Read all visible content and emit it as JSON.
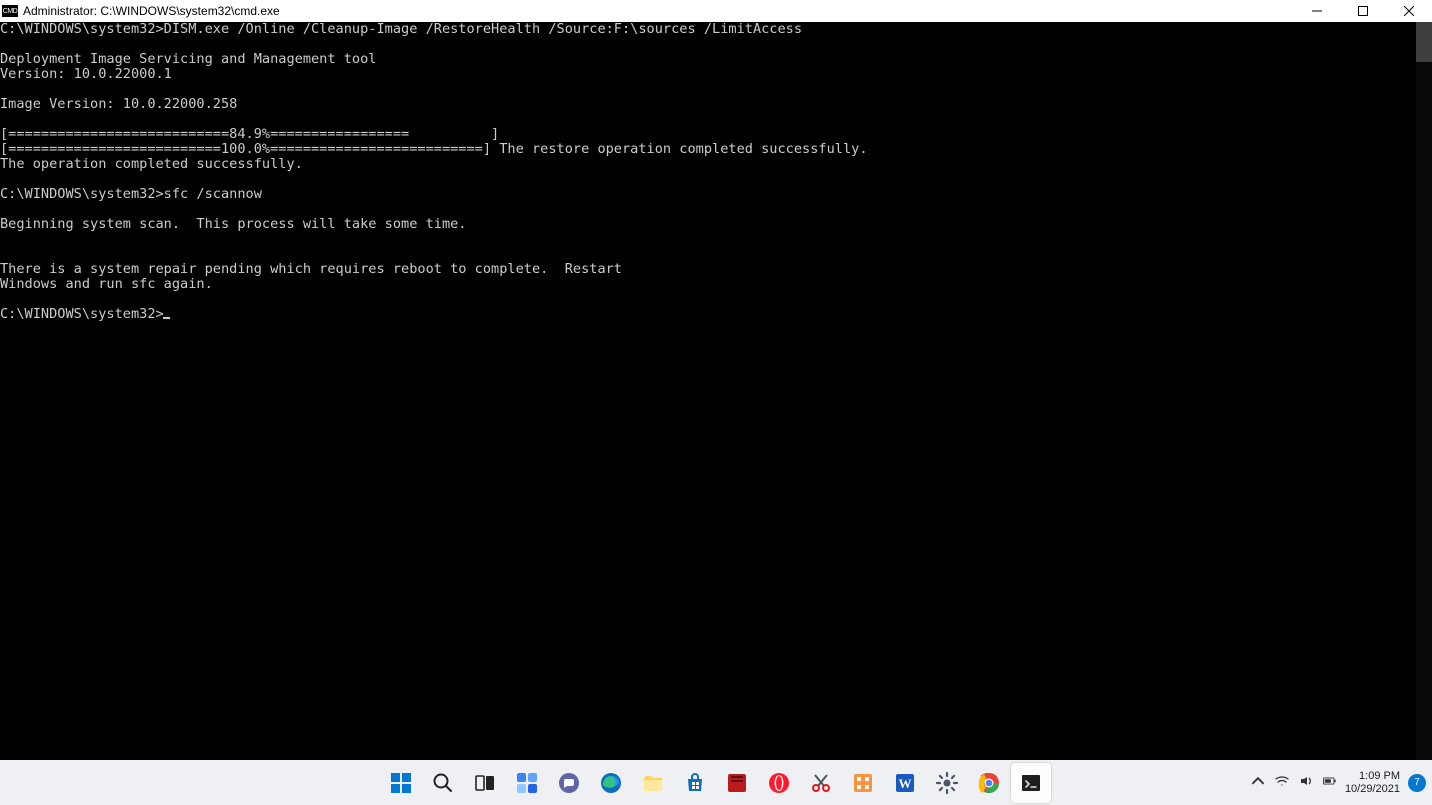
{
  "titlebar": {
    "icon_label": "CMD",
    "title": "Administrator: C:\\WINDOWS\\system32\\cmd.exe"
  },
  "terminal": {
    "lines": [
      "C:\\WINDOWS\\system32>DISM.exe /Online /Cleanup-Image /RestoreHealth /Source:F:\\sources /LimitAccess",
      "",
      "Deployment Image Servicing and Management tool",
      "Version: 10.0.22000.1",
      "",
      "Image Version: 10.0.22000.258",
      "",
      "[===========================84.9%=================          ]",
      "[==========================100.0%==========================] The restore operation completed successfully.",
      "The operation completed successfully.",
      "",
      "C:\\WINDOWS\\system32>sfc /scannow",
      "",
      "Beginning system scan.  This process will take some time.",
      "",
      "",
      "There is a system repair pending which requires reboot to complete.  Restart",
      "Windows and run sfc again.",
      "",
      "C:\\WINDOWS\\system32>"
    ]
  },
  "taskbar": {
    "items": [
      {
        "name": "start",
        "label": "Start"
      },
      {
        "name": "search",
        "label": "Search"
      },
      {
        "name": "task-view",
        "label": "Task View"
      },
      {
        "name": "widgets",
        "label": "Widgets"
      },
      {
        "name": "chat",
        "label": "Chat"
      },
      {
        "name": "edge",
        "label": "Microsoft Edge"
      },
      {
        "name": "explorer",
        "label": "File Explorer"
      },
      {
        "name": "store",
        "label": "Microsoft Store"
      },
      {
        "name": "app-red",
        "label": "App"
      },
      {
        "name": "opera",
        "label": "Opera"
      },
      {
        "name": "snip",
        "label": "Snip"
      },
      {
        "name": "util",
        "label": "Utility"
      },
      {
        "name": "word",
        "label": "Word"
      },
      {
        "name": "settings",
        "label": "Settings"
      },
      {
        "name": "chrome",
        "label": "Chrome"
      },
      {
        "name": "terminal",
        "label": "Terminal",
        "active": true
      }
    ]
  },
  "tray": {
    "time": "1:09 PM",
    "date": "10/29/2021",
    "badge": "7"
  }
}
